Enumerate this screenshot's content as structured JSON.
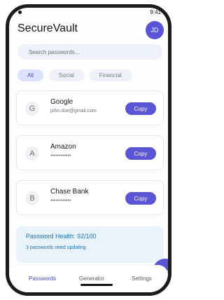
{
  "status_bar": {
    "time": "9:41"
  },
  "header": {
    "title": "SecureVault",
    "avatar_initials": "JD"
  },
  "search": {
    "placeholder": "Search passwords..."
  },
  "filters": [
    {
      "label": "All",
      "active": true
    },
    {
      "label": "Social",
      "active": false
    },
    {
      "label": "Financial",
      "active": false
    }
  ],
  "entries": [
    {
      "initial": "G",
      "name": "Google",
      "detail": "john.doe@gmail.com",
      "copy_label": "Copy"
    },
    {
      "initial": "A",
      "name": "Amazon",
      "detail": "••••••••••••",
      "copy_label": "Copy"
    },
    {
      "initial": "B",
      "name": "Chase Bank",
      "detail": "••••••••••••",
      "copy_label": "Copy"
    }
  ],
  "health": {
    "title": "Password Health: 92/100",
    "subtitle": "3 passwords need updating"
  },
  "fab": {
    "label": "+"
  },
  "nav": {
    "passwords": "Passwords",
    "generator": "Generator",
    "settings": "Settings"
  },
  "colors": {
    "accent": "#5a54d6",
    "health_bg": "#e8f3fb",
    "health_text": "#1f6fb0",
    "chip_active_bg": "#dbe2ff"
  }
}
